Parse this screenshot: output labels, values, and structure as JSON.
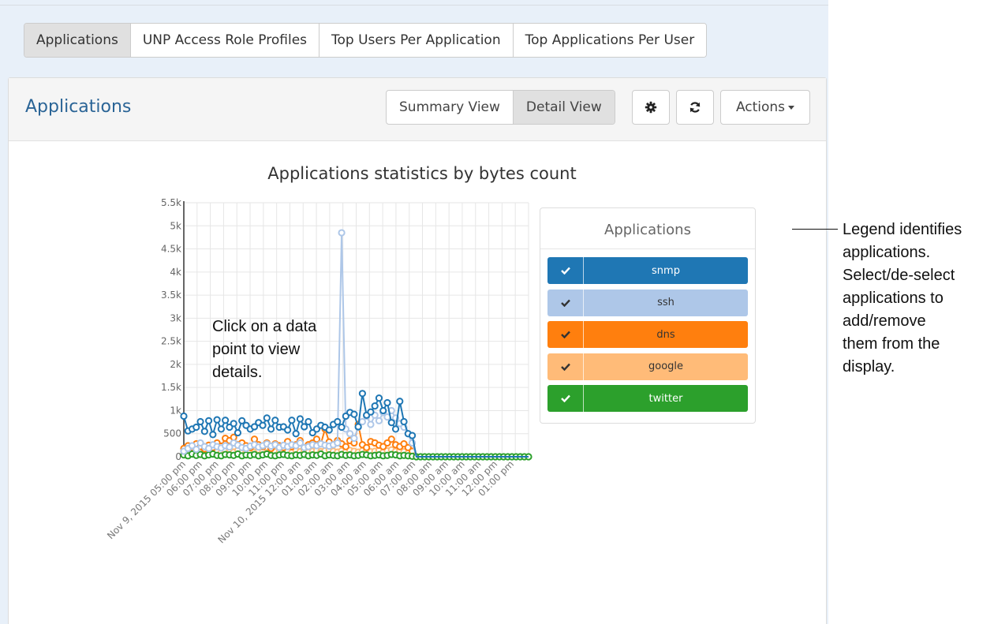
{
  "tabs": [
    {
      "label": "Applications",
      "active": true
    },
    {
      "label": "UNP Access Role Profiles",
      "active": false
    },
    {
      "label": "Top Users Per Application",
      "active": false
    },
    {
      "label": "Top Applications Per User",
      "active": false
    }
  ],
  "panel": {
    "title": "Applications",
    "summary_view_label": "Summary View",
    "detail_view_label": "Detail View",
    "settings_icon": "gear-icon",
    "refresh_icon": "refresh-icon",
    "actions_label": "Actions"
  },
  "legend": {
    "title": "Applications",
    "items": [
      {
        "label": "snmp",
        "color": "#1f77b4",
        "text_color": "#ffffff",
        "check_color": "#ffffff",
        "checked": true
      },
      {
        "label": "ssh",
        "color": "#aec7e8",
        "text_color": "#333333",
        "check_color": "#333333",
        "checked": true
      },
      {
        "label": "dns",
        "color": "#ff7f0e",
        "text_color": "#333333",
        "check_color": "#333333",
        "checked": true
      },
      {
        "label": "google",
        "color": "#ffbb78",
        "text_color": "#333333",
        "check_color": "#333333",
        "checked": true
      },
      {
        "label": "twitter",
        "color": "#2ca02c",
        "text_color": "#ffffff",
        "check_color": "#ffffff",
        "checked": true
      }
    ]
  },
  "annotations": {
    "chart_hint": [
      "Click on a data",
      "point to view",
      "details."
    ],
    "legend_note": [
      "Legend identifies",
      "applications.",
      "Select/de-select",
      "applications to",
      "add/remove",
      "them from the",
      "display."
    ]
  },
  "chart_data": {
    "type": "line",
    "title": "Applications statistics by bytes count",
    "xlabel": "",
    "ylabel": "",
    "ylim": [
      0,
      5500
    ],
    "yticks": [
      "0",
      "500",
      "1k",
      "1.5k",
      "2k",
      "2.5k",
      "3k",
      "3.5k",
      "4k",
      "4.5k",
      "5k",
      "5.5k"
    ],
    "xticks": [
      "Nov 9, 2015 05:00 pm",
      "06:00 pm",
      "07:00 pm",
      "08:00 pm",
      "09:00 pm",
      "10:00 pm",
      "11:00 pm",
      "Nov 10, 2015 12:00 am",
      "01:00 am",
      "02:00 am",
      "03:00 am",
      "04:00 am",
      "05:00 am",
      "06:00 am",
      "07:00 am",
      "08:00 am",
      "09:00 am",
      "10:00 am",
      "11:00 am",
      "12:00 pm",
      "01:00 pm"
    ],
    "grid": true,
    "series": [
      {
        "name": "snmp",
        "color": "#1f77b4",
        "values": [
          880,
          560,
          600,
          640,
          760,
          550,
          780,
          480,
          800,
          600,
          790,
          640,
          720,
          520,
          780,
          680,
          600,
          650,
          740,
          680,
          840,
          600,
          790,
          640,
          650,
          580,
          790,
          500,
          820,
          650,
          760,
          520,
          600,
          680,
          640,
          580,
          700,
          760,
          640,
          880,
          960,
          920,
          650,
          1370,
          900,
          970,
          1100,
          1270,
          1000,
          1170,
          740,
          600,
          1200,
          760,
          500,
          460,
          0,
          0,
          0,
          0,
          0,
          0,
          0,
          0,
          0,
          0,
          0,
          0,
          0,
          0,
          0,
          0,
          0,
          0,
          0,
          0,
          0,
          0,
          0,
          0,
          0,
          0,
          0,
          0
        ]
      },
      {
        "name": "ssh",
        "color": "#aec7e8",
        "values": [
          120,
          180,
          240,
          160,
          300,
          220,
          180,
          260,
          220,
          190,
          240,
          210,
          300,
          250,
          200,
          180,
          230,
          260,
          210,
          240,
          280,
          230,
          260,
          200,
          250,
          220,
          260,
          240,
          300,
          200,
          220,
          260,
          240,
          280,
          250,
          230,
          260,
          300,
          4850,
          600,
          500,
          400,
          640,
          760,
          880,
          700,
          900,
          780,
          960,
          860,
          1000,
          840,
          720,
          640,
          500,
          300,
          0,
          0,
          0,
          0,
          0,
          0,
          0,
          0,
          0,
          0,
          0,
          0,
          0,
          0,
          0,
          0,
          0,
          0,
          0,
          0,
          0,
          0,
          0,
          0,
          0,
          0,
          0,
          0
        ]
      },
      {
        "name": "dns",
        "color": "#ff7f0e",
        "values": [
          180,
          240,
          200,
          280,
          220,
          170,
          250,
          200,
          300,
          230,
          400,
          350,
          420,
          260,
          300,
          240,
          200,
          380,
          260,
          220,
          300,
          180,
          280,
          240,
          200,
          330,
          220,
          260,
          350,
          200,
          260,
          300,
          380,
          280,
          600,
          320,
          260,
          350,
          280,
          220,
          350,
          300,
          700,
          260,
          200,
          330,
          300,
          250,
          220,
          300,
          380,
          260,
          220,
          280,
          200,
          120,
          0,
          0,
          0,
          0,
          0,
          0,
          0,
          0,
          0,
          0,
          0,
          0,
          0,
          0,
          0,
          0,
          0,
          0,
          0,
          0,
          0,
          0,
          0,
          0,
          0,
          0,
          0,
          0
        ]
      },
      {
        "name": "google",
        "color": "#ffbb78",
        "values": [
          60,
          80,
          120,
          90,
          140,
          100,
          80,
          150,
          110,
          90,
          120,
          160,
          100,
          140,
          90,
          110,
          130,
          100,
          150,
          120,
          90,
          130,
          110,
          100,
          150,
          120,
          90,
          140,
          110,
          130,
          100,
          120,
          140,
          110,
          130,
          150,
          120,
          100,
          130,
          110,
          140,
          120,
          100,
          130,
          150,
          110,
          120,
          140,
          100,
          130,
          150,
          120,
          140,
          110,
          80,
          40,
          0,
          0,
          0,
          0,
          0,
          0,
          0,
          0,
          0,
          0,
          0,
          0,
          0,
          0,
          0,
          0,
          0,
          0,
          0,
          0,
          0,
          0,
          0,
          0,
          0,
          0,
          0,
          0
        ]
      },
      {
        "name": "twitter",
        "color": "#2ca02c",
        "values": [
          40,
          20,
          60,
          30,
          50,
          20,
          40,
          60,
          30,
          20,
          50,
          40,
          30,
          60,
          20,
          40,
          30,
          50,
          20,
          40,
          60,
          30,
          20,
          40,
          50,
          30,
          20,
          40,
          30,
          50,
          20,
          40,
          30,
          60,
          20,
          40,
          30,
          20,
          50,
          30,
          40,
          20,
          30,
          50,
          40,
          20,
          30,
          40,
          20,
          30,
          50,
          40,
          20,
          30,
          20,
          10,
          0,
          0,
          0,
          0,
          0,
          0,
          0,
          0,
          0,
          0,
          0,
          0,
          0,
          0,
          0,
          0,
          0,
          0,
          0,
          0,
          0,
          0,
          0,
          0,
          0,
          0,
          0,
          0
        ]
      }
    ]
  }
}
